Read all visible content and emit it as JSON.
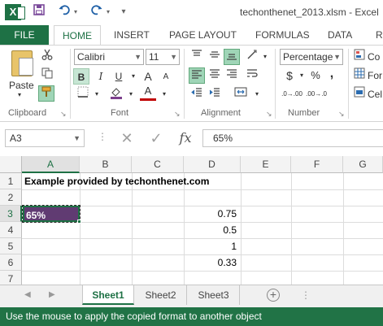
{
  "window": {
    "title": "techonthenet_2013.xlsm - Excel",
    "app_logo": "X"
  },
  "quick_access": {
    "save_icon": "save-icon",
    "undo_icon": "undo-icon",
    "redo_icon": "redo-icon"
  },
  "tabs": {
    "file": "FILE",
    "items": [
      "HOME",
      "INSERT",
      "PAGE LAYOUT",
      "FORMULAS",
      "DATA",
      "R"
    ],
    "active": "HOME"
  },
  "ribbon": {
    "clipboard": {
      "label": "Clipboard",
      "paste": "Paste"
    },
    "font": {
      "label": "Font",
      "font_name": "Calibri",
      "font_size": "11",
      "bold": "B",
      "italic": "I",
      "underline": "U",
      "grow": "A",
      "shrink": "A",
      "font_color_letter": "A"
    },
    "alignment": {
      "label": "Alignment"
    },
    "number": {
      "label": "Number",
      "format": "Percentage",
      "currency": "$",
      "percent": "%",
      "comma": ",",
      "inc_decimal": ".0→.00",
      "dec_decimal": ".00→.0"
    },
    "styles": {
      "conditional": "Co",
      "format_table": "For",
      "cell_styles": "Cel"
    }
  },
  "formula_bar": {
    "name_box": "A3",
    "cancel": "✕",
    "enter": "✓",
    "fx": "fx",
    "value": "65%"
  },
  "grid": {
    "columns": [
      "A",
      "B",
      "C",
      "D",
      "E",
      "F",
      "G"
    ],
    "active_column": "A",
    "rows": [
      "1",
      "2",
      "3",
      "4",
      "5",
      "6",
      "7"
    ],
    "active_row": "3",
    "cells": {
      "A1": "Example provided by techonthenet.com",
      "A3": "65%",
      "D3": "0.75",
      "D4": "0.5",
      "D5": "1",
      "D6": "0.33"
    },
    "selected_fill": "#603b72"
  },
  "sheets": {
    "items": [
      "Sheet1",
      "Sheet2",
      "Sheet3"
    ],
    "active": "Sheet1",
    "add": "+"
  },
  "status_bar": {
    "message": "Use the mouse to apply the copied format to another object"
  },
  "colors": {
    "brand_green": "#217346",
    "selected_cell": "#603b72"
  }
}
